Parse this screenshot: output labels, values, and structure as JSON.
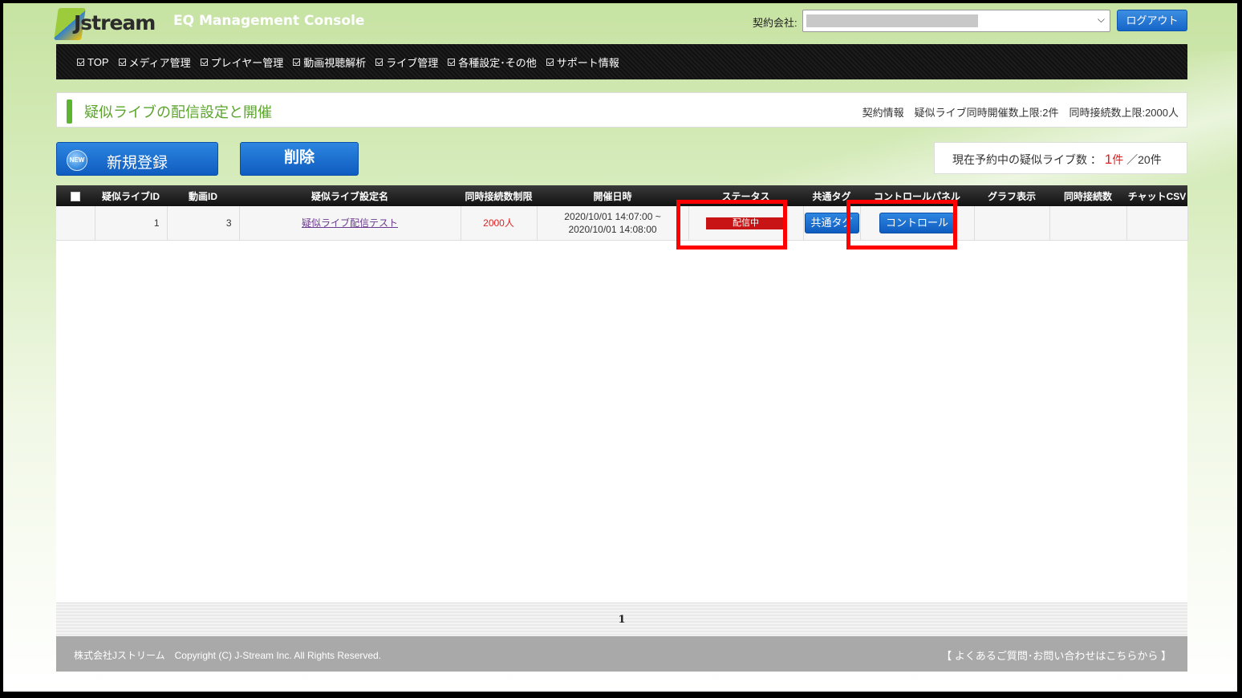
{
  "header": {
    "logo_text": "Jstream",
    "console_title": "EQ Management Console",
    "company_label": "契約会社:",
    "logout_label": "ログアウト"
  },
  "nav": {
    "items": [
      {
        "label": "TOP"
      },
      {
        "label": "メディア管理"
      },
      {
        "label": "プレイヤー管理"
      },
      {
        "label": "動画視聴解析"
      },
      {
        "label": "ライブ管理"
      },
      {
        "label": "各種設定･その他"
      },
      {
        "label": "サポート情報"
      }
    ]
  },
  "page": {
    "title": "疑似ライブの配信設定と開催",
    "contract_info": "契約情報　疑似ライブ同時開催数上限:2件　同時接続数上限:2000人"
  },
  "actions": {
    "new_badge": "NEW",
    "new_label": "新規登録",
    "delete_label": "削除"
  },
  "reserve": {
    "label": "現在予約中の疑似ライブ数 ：",
    "count": "1",
    "count_unit": "件",
    "total": "／20件"
  },
  "table": {
    "headers": [
      "疑似ライブID",
      "動画ID",
      "疑似ライブ設定名",
      "同時接続数制限",
      "開催日時",
      "ステータス",
      "共通タグ",
      "コントロールパネル",
      "グラフ表示",
      "同時接続数",
      "チャットCSV"
    ],
    "rows": [
      {
        "live_id": "1",
        "video_id": "3",
        "name": "疑似ライブ配信テスト",
        "limit": "2000人",
        "date_start": "2020/10/01 14:07:00 ~",
        "date_end": "2020/10/01 14:08:00",
        "status": "配信中",
        "tag_button": "共通タグ",
        "control_button": "コントロール"
      }
    ]
  },
  "pager": {
    "current": "1"
  },
  "footer": {
    "copyright": "株式会社Jストリーム　Copyright (C) J-Stream Inc. All Rights Reserved.",
    "faq": "【 よくあるご質問･お問い合わせはこちらから 】"
  },
  "colors": {
    "accent_green": "#5aa52a",
    "button_blue": "#1565c8",
    "status_red": "#c81414",
    "highlight_red": "#ff0000"
  }
}
